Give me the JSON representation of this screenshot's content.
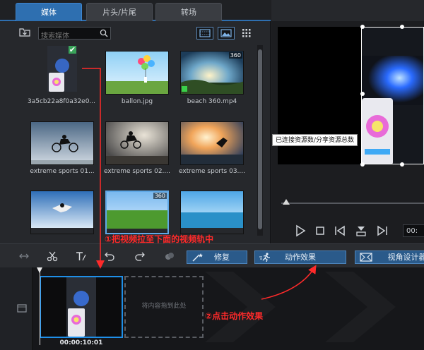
{
  "media_panel": {
    "tabs": [
      {
        "label": "媒体"
      },
      {
        "label": "片头/片尾"
      },
      {
        "label": "转场"
      }
    ],
    "search": {
      "placeholder": "搜索媒体",
      "value": ""
    },
    "items": [
      {
        "label": "3a5cb22a8f0a32e0...",
        "badge": ""
      },
      {
        "label": "ballon.jpg",
        "badge": ""
      },
      {
        "label": "beach 360.mp4",
        "badge": "360"
      },
      {
        "label": "extreme sports 01...",
        "badge": ""
      },
      {
        "label": "extreme sports 02....",
        "badge": ""
      },
      {
        "label": "extreme sports 03....",
        "badge": ""
      },
      {
        "label": "",
        "badge": ""
      },
      {
        "label": "",
        "badge": "360"
      },
      {
        "label": "",
        "badge": ""
      }
    ]
  },
  "preview": {
    "tooltip": "已连接资源数/分享资源总数",
    "timecode": "00:"
  },
  "timeline_toolbar": {
    "repair_label": "修复",
    "action_effect_label": "动作效果",
    "view_designer_label": "视角设计器"
  },
  "timeline": {
    "drop_hint": "将内容拖到此处",
    "clip_time": "00:00:10:01"
  },
  "annotations": {
    "step1": "①把视频拉至下面的视频轨中",
    "step2": "②点击动作效果"
  },
  "colors": {
    "accent": "#2e6fb0",
    "annotation_red": "#ff2a2a",
    "clip_border": "#1f8fe8"
  }
}
